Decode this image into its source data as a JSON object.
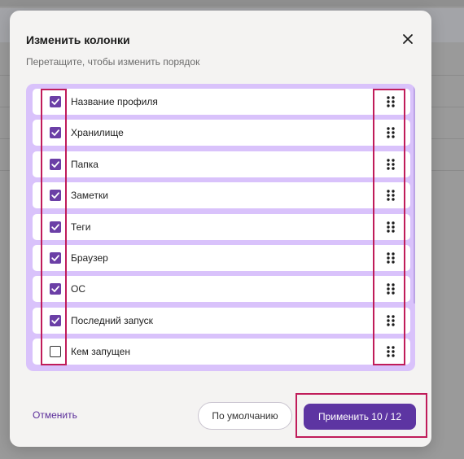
{
  "dialog": {
    "title": "Изменить колонки",
    "subtitle": "Перетащите, чтобы изменить порядок",
    "close_icon": "close-icon"
  },
  "columns": [
    {
      "label": "Название профиля",
      "checked": true
    },
    {
      "label": "Хранилище",
      "checked": true
    },
    {
      "label": "Папка",
      "checked": true
    },
    {
      "label": "Заметки",
      "checked": true
    },
    {
      "label": "Теги",
      "checked": true
    },
    {
      "label": "Браузер",
      "checked": true
    },
    {
      "label": "ОС",
      "checked": true
    },
    {
      "label": "Последний запуск",
      "checked": true
    },
    {
      "label": "Кем запущен",
      "checked": false
    }
  ],
  "footer": {
    "cancel_label": "Отменить",
    "default_label": "По умолчанию",
    "apply_label": "Применить 10 / 12"
  },
  "colors": {
    "accent": "#5d35a2",
    "list_background": "#d9c2fb",
    "checkbox_checked": "#6b3fa6",
    "highlight_outline": "#c01c5a"
  },
  "icons": {
    "checkbox_on": "check-icon",
    "drag": "drag-handle-icon"
  }
}
